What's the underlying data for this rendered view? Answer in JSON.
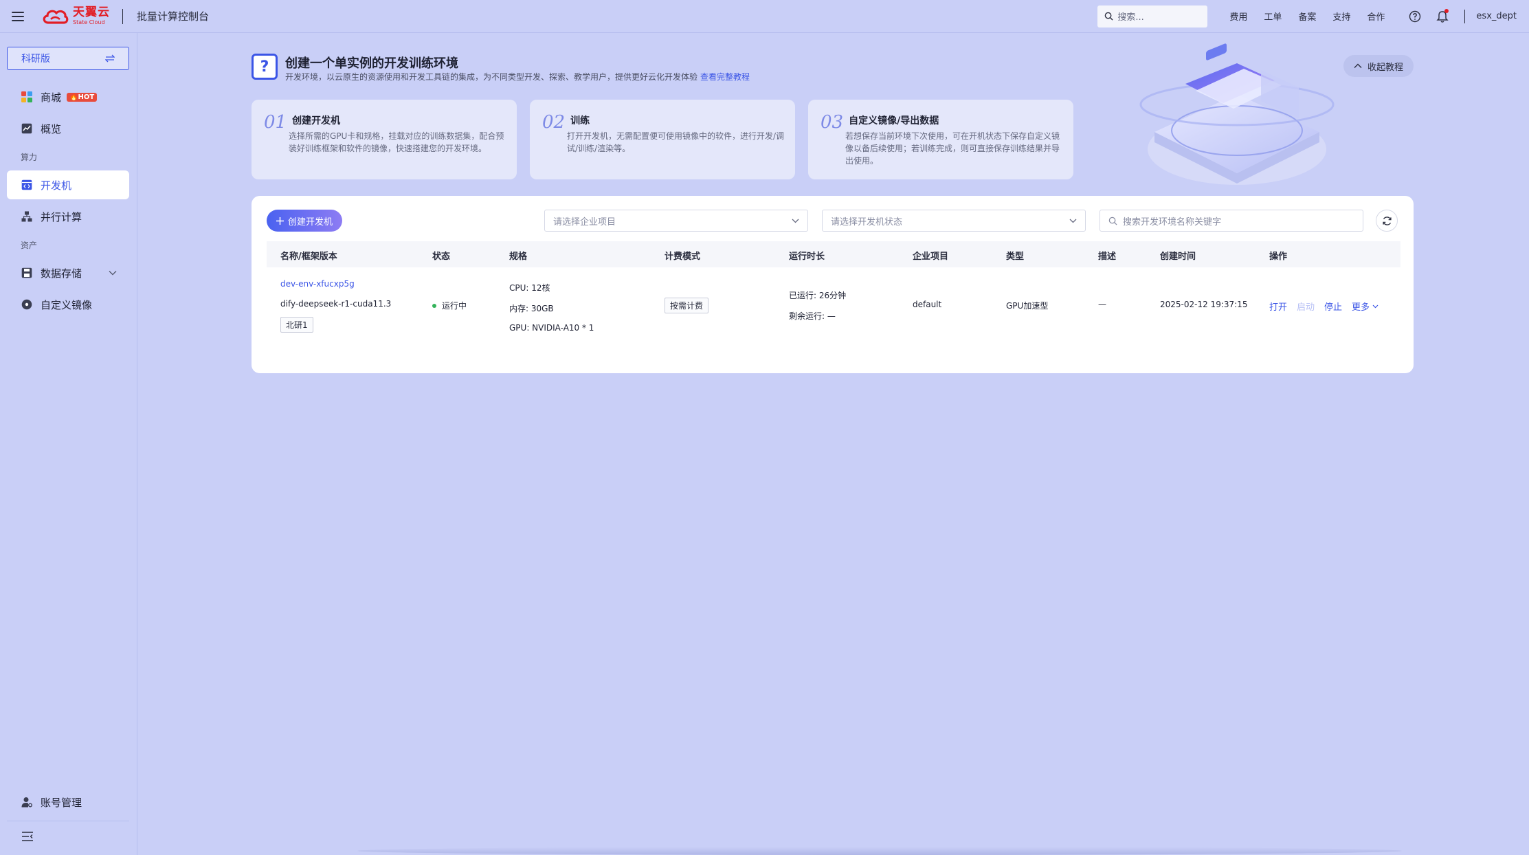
{
  "topbar": {
    "logo_cn": "天翼云",
    "logo_en": "State Cloud",
    "console_title": "批量计算控制台",
    "search_placeholder": "搜索...",
    "links": [
      "费用",
      "工单",
      "备案",
      "支持",
      "合作"
    ],
    "user": "esx_dept"
  },
  "sidebar": {
    "edition": "科研版",
    "items": [
      {
        "label": "商城",
        "badge": "HOT"
      },
      {
        "label": "概览"
      },
      {
        "label": "开发机"
      },
      {
        "label": "并行计算"
      },
      {
        "label": "数据存储"
      },
      {
        "label": "自定义镜像"
      },
      {
        "label": "账号管理"
      }
    ],
    "groups": [
      "算力",
      "资产"
    ]
  },
  "intro": {
    "title": "创建一个单实例的开发训练环境",
    "desc": "开发环境，以云原生的资源使用和开发工具链的集成，为不同类型开发、探索、教学用户，提供更好云化开发体验",
    "link": "查看完整教程",
    "collapse": "收起教程"
  },
  "steps": [
    {
      "num": "01",
      "title": "创建开发机",
      "desc": "选择所需的GPU卡和规格，挂载对应的训练数据集，配合预装好训练框架和软件的镜像，快速搭建您的开发环境。"
    },
    {
      "num": "02",
      "title": "训练",
      "desc": "打开开发机，无需配置便可使用镜像中的软件，进行开发/调试/训练/渲染等。"
    },
    {
      "num": "03",
      "title": "自定义镜像/导出数据",
      "desc": "若想保存当前环境下次使用，可在开机状态下保存自定义镜像以备后续使用；若训练完成，则可直接保存训练结果并导出使用。"
    }
  ],
  "toolbar": {
    "create": "创建开发机",
    "project_placeholder": "请选择企业项目",
    "status_placeholder": "请选择开发机状态",
    "search_placeholder": "搜索开发环境名称关键字"
  },
  "table": {
    "headers": [
      "名称/框架版本",
      "状态",
      "规格",
      "计费模式",
      "运行时长",
      "企业项目",
      "类型",
      "描述",
      "创建时间",
      "操作"
    ],
    "row": {
      "name": "dev-env-xfucxp5g",
      "framework": "dify-deepseek-r1-cuda11.3",
      "region": "北研1",
      "status": "运行中",
      "cpu": "CPU: 12核",
      "memory": "内存: 30GB",
      "gpu": "GPU: NVIDIA-A10 * 1",
      "billing": "按需计费",
      "ran": "已运行: 26分钟",
      "remaining": "剩余运行: —",
      "project": "default",
      "type": "GPU加速型",
      "desc": "—",
      "created": "2025-02-12 19:37:15",
      "ops": {
        "open": "打开",
        "start": "启动",
        "stop": "停止",
        "more": "更多"
      }
    }
  },
  "colors": {
    "accent": "#3b55e6",
    "background": "#c9cff7",
    "status_running": "#34b35a",
    "brand_red": "#e21d25"
  }
}
